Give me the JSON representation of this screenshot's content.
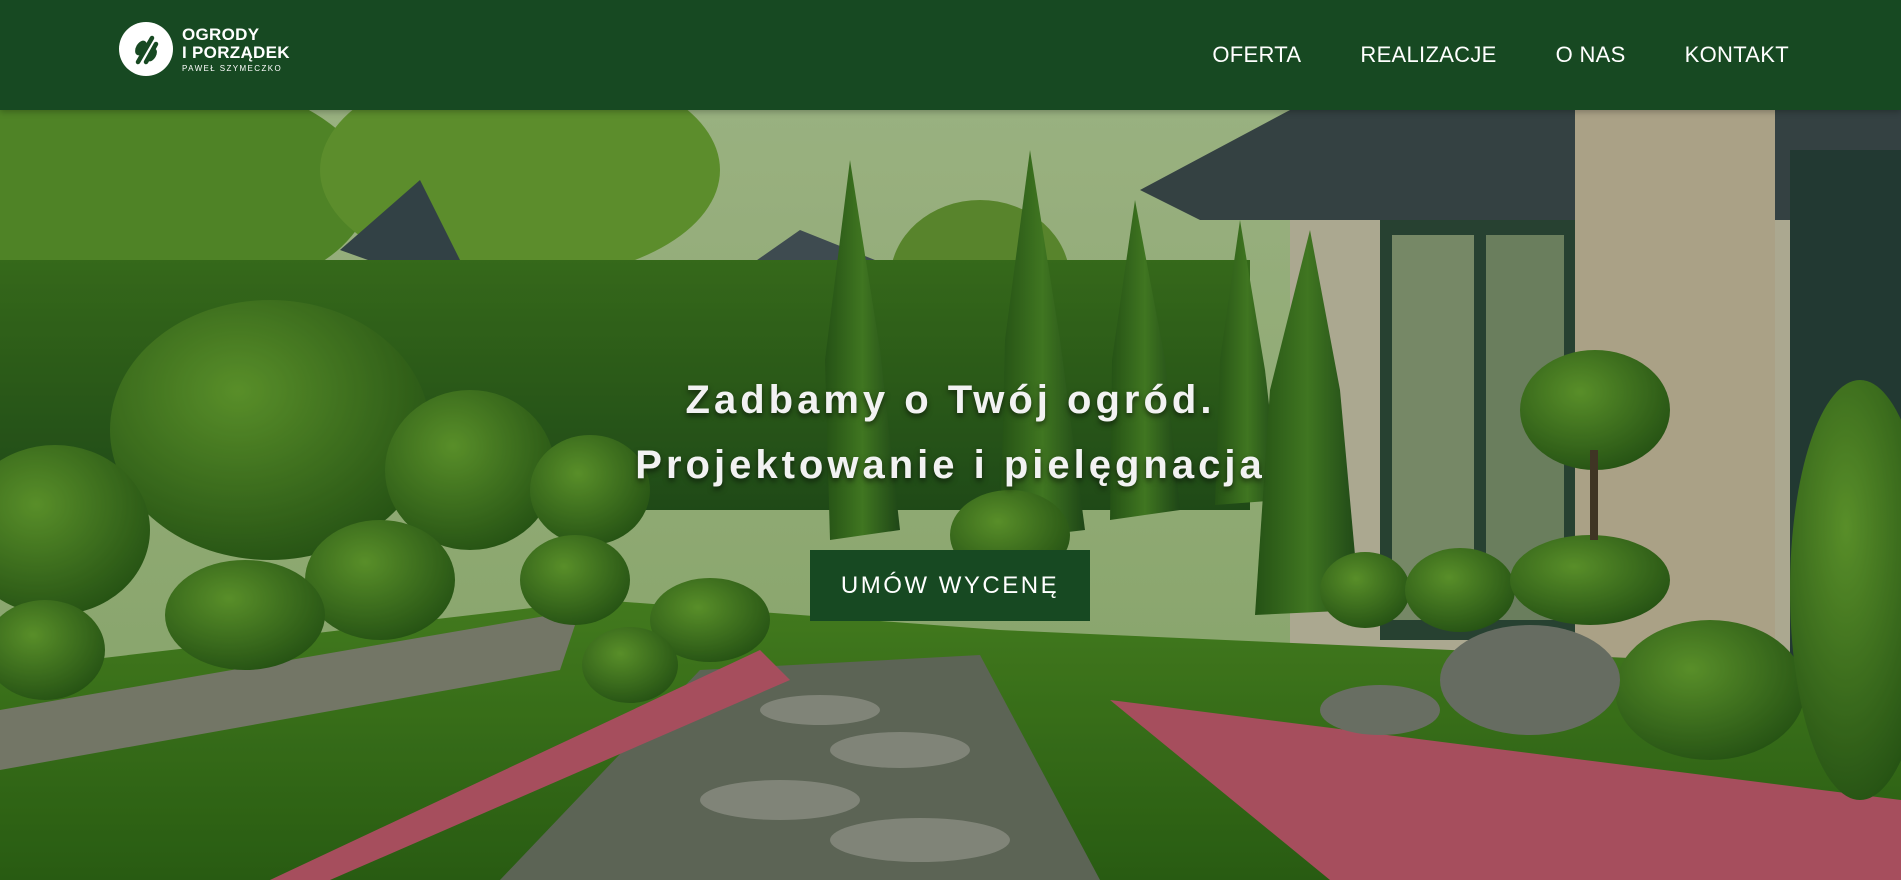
{
  "brand": {
    "line1": "OGRODY",
    "line2": "I PORZĄDEK",
    "subtitle": "PAWEŁ SZYMECZKO"
  },
  "nav": {
    "items": [
      {
        "label": "OFERTA"
      },
      {
        "label": "REALIZACJE"
      },
      {
        "label": "O NAS"
      },
      {
        "label": "KONTAKT"
      }
    ]
  },
  "hero": {
    "headline_line1": "Zadbamy o Twój ogród.",
    "headline_line2": "Projektowanie i pielęgnacja",
    "cta_label": "UMÓW WYCENĘ"
  },
  "colors": {
    "header_bg": "#174922",
    "cta_bg": "#174922",
    "text": "#ffffff"
  },
  "icons": {
    "logo": "garden-shears-logo-icon"
  }
}
